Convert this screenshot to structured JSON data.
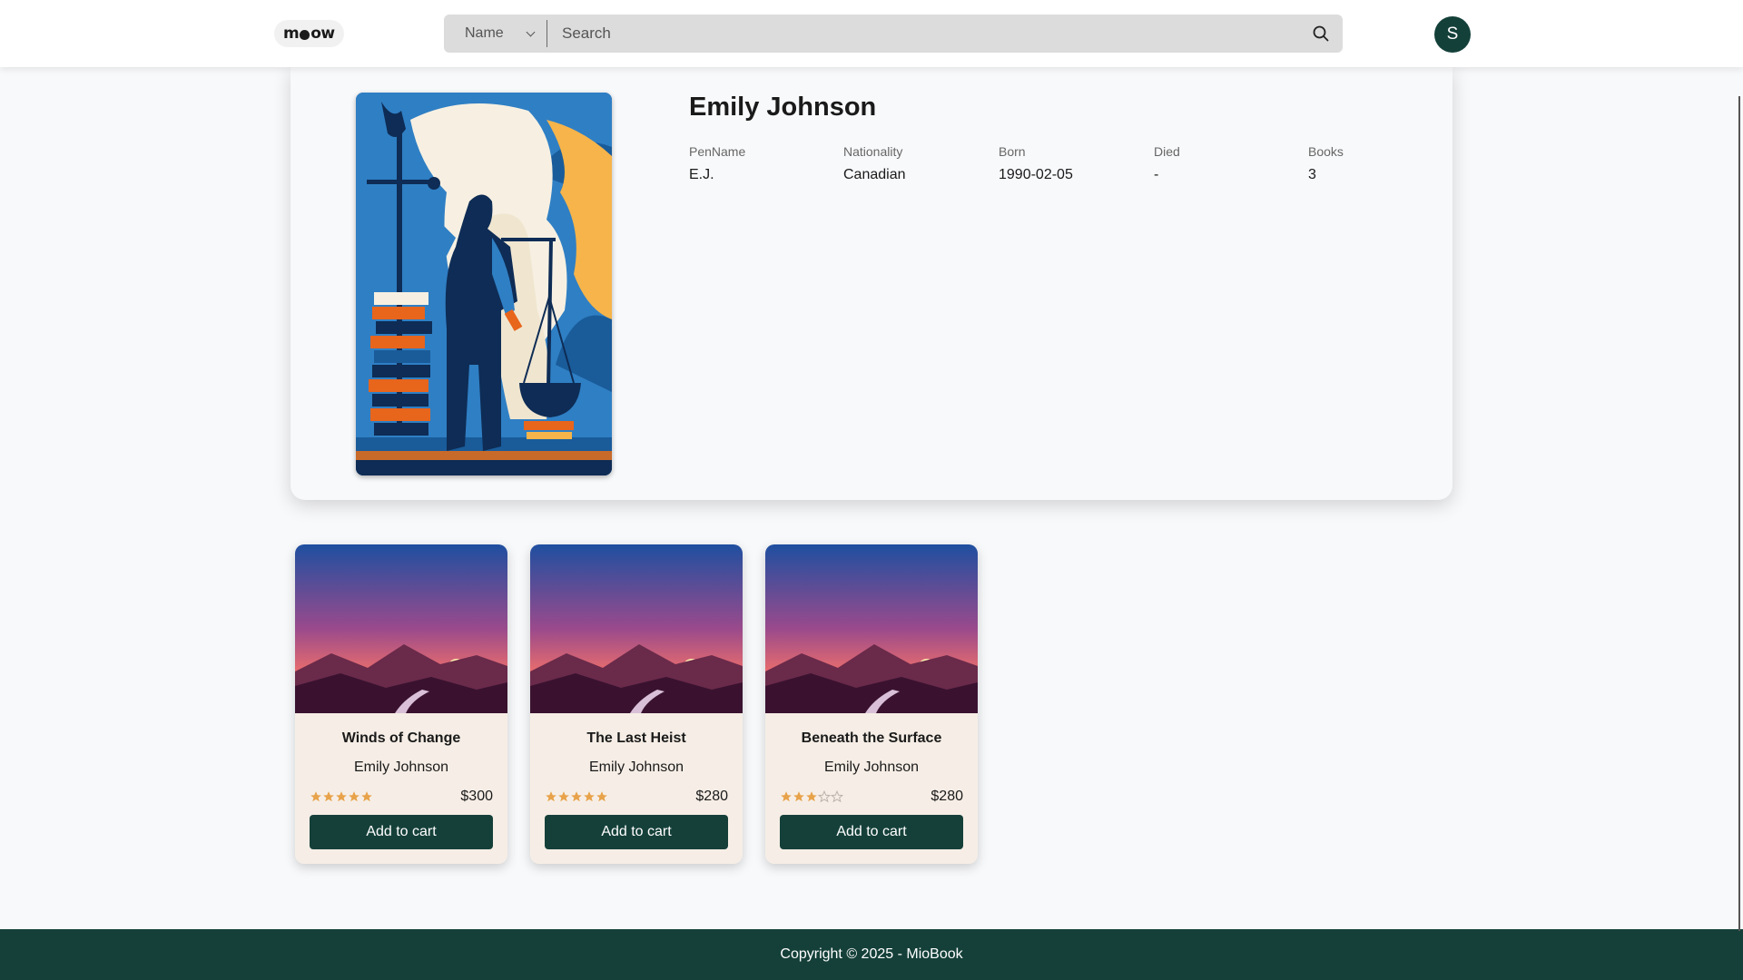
{
  "header": {
    "logo_text_left": "m",
    "logo_text_right": "ow",
    "search_filter": "Name",
    "search_placeholder": "Search",
    "avatar_initial": "S"
  },
  "author": {
    "name": "Emily Johnson",
    "fields": [
      {
        "label": "PenName",
        "value": "E.J."
      },
      {
        "label": "Nationality",
        "value": "Canadian"
      },
      {
        "label": "Born",
        "value": "1990-02-05"
      },
      {
        "label": "Died",
        "value": "-"
      },
      {
        "label": "Books",
        "value": "3"
      }
    ]
  },
  "books": [
    {
      "title": "Winds of Change",
      "author": "Emily Johnson",
      "rating": 5,
      "price": "$300",
      "button": "Add to cart"
    },
    {
      "title": "The Last Heist",
      "author": "Emily Johnson",
      "rating": 5,
      "price": "$280",
      "button": "Add to cart"
    },
    {
      "title": "Beneath the Surface",
      "author": "Emily Johnson",
      "rating": 3,
      "price": "$280",
      "button": "Add to cart"
    }
  ],
  "footer": {
    "copyright": "Copyright © 2025 - MioBook"
  },
  "colors": {
    "primary": "#15403a",
    "star": "#e8a24a",
    "card_bg": "#f6eee6"
  },
  "icons": {
    "search": "search-icon",
    "chevron": "chevron-down-icon",
    "star": "star-icon"
  }
}
